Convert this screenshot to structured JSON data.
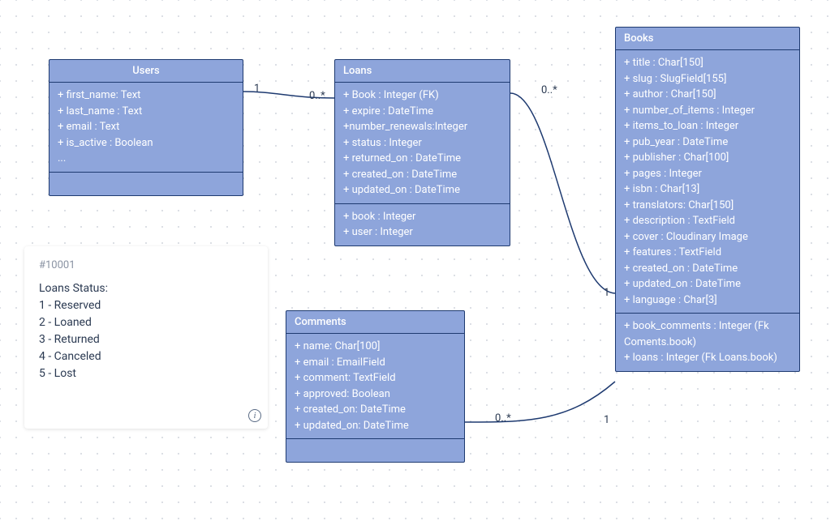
{
  "entities": {
    "users": {
      "title": "Users",
      "fields": [
        "+ first_name: Text",
        "+ last_name : Text",
        "+ email : Text",
        "+ is_active : Boolean",
        "..."
      ]
    },
    "loans": {
      "title": "Loans",
      "fields": [
        "+ Book : Integer (FK)",
        "+ expire : DateTime",
        "+number_renewals:Integer",
        "+ status : Integer",
        "+ returned_on : DateTime",
        "+ created_on : DateTime",
        "+ updated_on : DateTime"
      ],
      "refs": [
        "+ book : Integer",
        "+ user : Integer"
      ]
    },
    "books": {
      "title": "Books",
      "fields": [
        "+ title : Char[150]",
        "+ slug : SlugField[155]",
        "+ author : Char[150]",
        "+ number_of_items : Integer",
        "+ items_to_loan : Integer",
        "+ pub_year : DateTime",
        "+ publisher : Char[100]",
        "+ pages : Integer",
        "+ isbn : Char[13]",
        "+ translators: Char[150]",
        "+ description : TextField",
        "+ cover : Cloudinary Image",
        "+ features : TextField",
        "+ created_on : DateTime",
        "+ updated_on : DateTime",
        "+ language : Char[3]"
      ],
      "refs": [
        "+ book_comments : Integer (Fk Coments.book)",
        "+ loans : Integer (Fk Loans.book)"
      ]
    },
    "comments": {
      "title": "Comments",
      "fields": [
        "+ name: Char[100]",
        "+ email : EmailField",
        "+ comment: TextField",
        "+ approved: Boolean",
        "+ created_on: DateTime",
        "+ updated_on: DateTime"
      ]
    }
  },
  "note": {
    "id": "#10001",
    "title": "Loans Status:",
    "lines": [
      "1 - Reserved",
      "2 - Loaned",
      "3 - Returned",
      "4 - Canceled",
      "5 - Lost"
    ]
  },
  "cardinalities": {
    "users_loans_left": "1",
    "users_loans_right": "0..*",
    "loans_books_left": "0..*",
    "loans_books_right": "1",
    "comments_books_left": "0..*",
    "comments_books_right": "1"
  }
}
